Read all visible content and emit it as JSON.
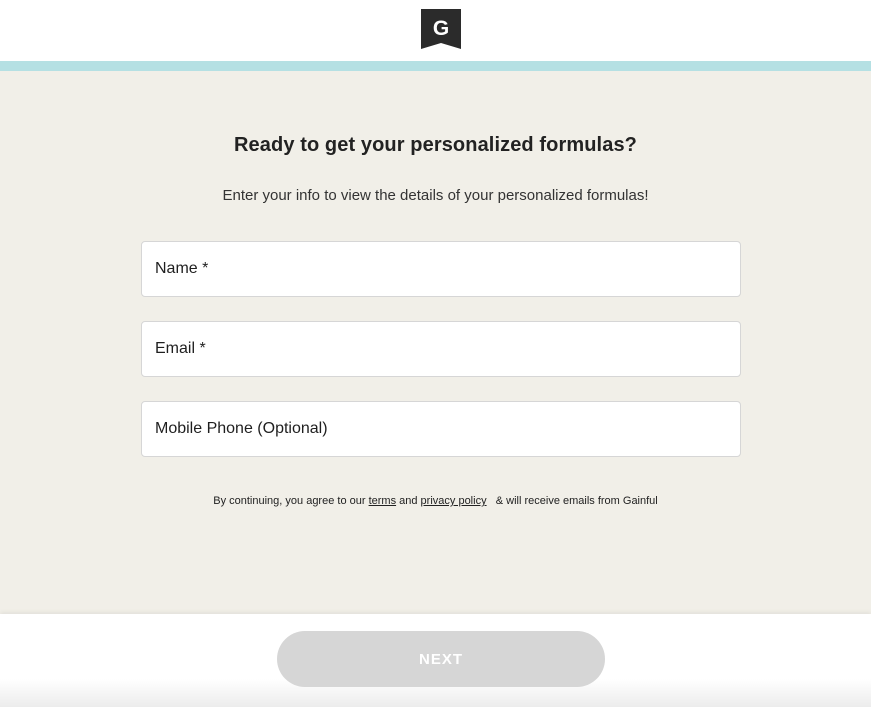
{
  "header": {
    "logo_letter": "G",
    "logo_icon": "gainful-logo-icon",
    "accent_color": "#b5e0e3"
  },
  "main": {
    "title": "Ready to get your personalized formulas?",
    "subtitle": "Enter your info to view the details of your personalized formulas!",
    "fields": {
      "name": {
        "placeholder": "Name *",
        "value": ""
      },
      "email": {
        "placeholder": "Email *",
        "value": ""
      },
      "phone": {
        "placeholder": "Mobile Phone (Optional)",
        "value": ""
      }
    },
    "legal": {
      "prefix": "By continuing, you agree to our ",
      "terms_link": "terms",
      "middle": " and ",
      "privacy_link": "privacy policy",
      "suffix": "   & will receive emails from Gainful"
    },
    "background_color": "#f1efe8"
  },
  "footer": {
    "next_label": "NEXT",
    "next_button_color": "#d6d6d6",
    "next_enabled": false
  }
}
